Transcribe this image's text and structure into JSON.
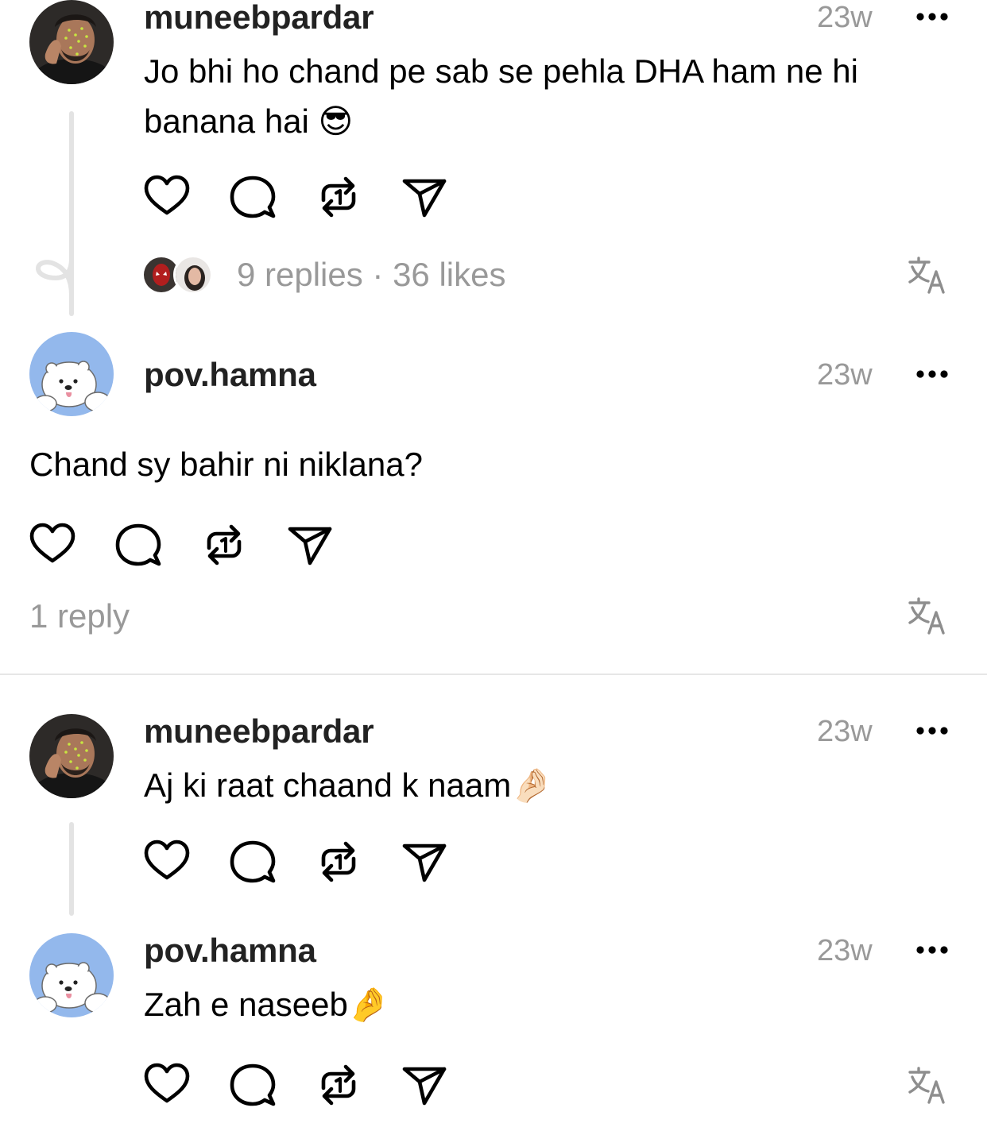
{
  "comments": [
    {
      "username": "muneebpardar",
      "time": "23w",
      "text": "Jo bhi ho chand pe sab se pehla DHA ham ne hi banana hai 😎",
      "replies_meta": "9 replies · 36 likes"
    },
    {
      "username": "pov.hamna",
      "time": "23w",
      "text": "Chand sy bahir ni niklana?",
      "replies_meta": "1 reply"
    },
    {
      "username": "muneebpardar",
      "time": "23w",
      "text": "Aj ki raat chaand k naam🤌🏻"
    },
    {
      "username": "pov.hamna",
      "time": "23w",
      "text": "Zah e naseeb🤌"
    }
  ],
  "icons": {
    "like": "heart-icon",
    "reply": "comment-bubble-icon",
    "repost": "repost-icon",
    "share": "send-icon",
    "more": "more-dots-icon",
    "translate": "translate-icon"
  },
  "colors": {
    "muted_text": "#999999",
    "thread_line": "#e3e3e3",
    "bear_avatar_bg": "#93b8ec"
  }
}
